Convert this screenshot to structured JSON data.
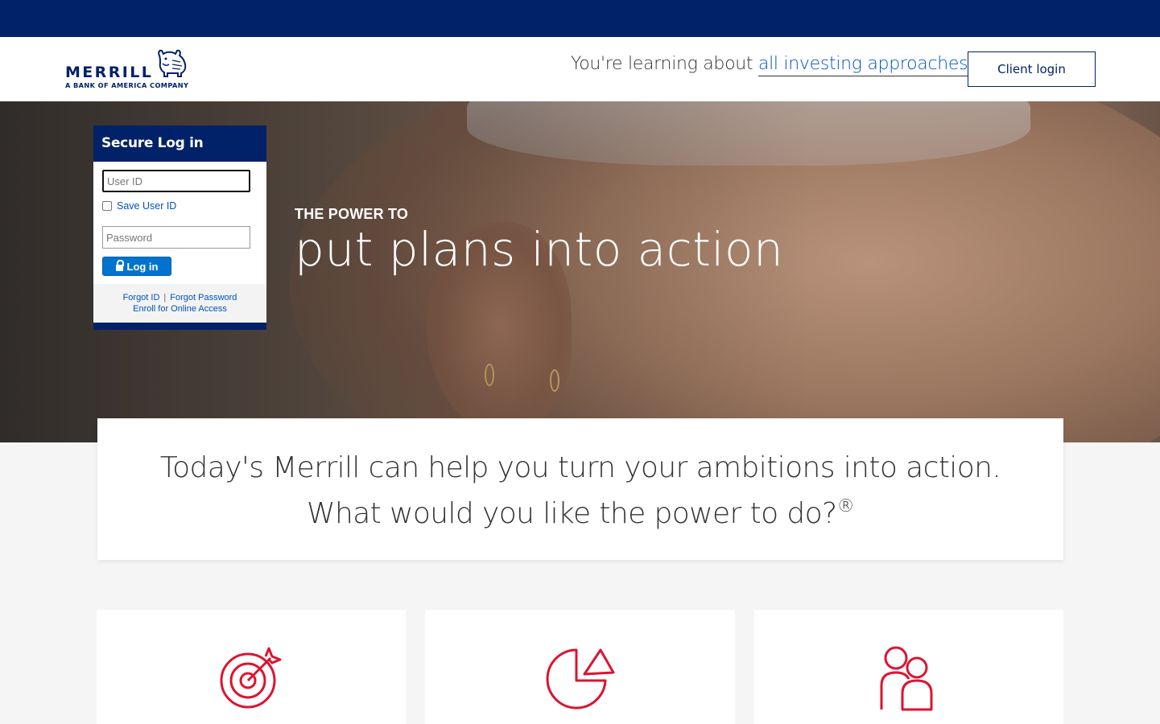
{
  "header": {
    "logo_word": "MERRILL",
    "logo_sub": "A BANK OF AMERICA COMPANY",
    "learning_prefix": "You're learning about ",
    "learning_selected": "all investing approaches",
    "client_login_label": "Client login"
  },
  "hero": {
    "eyebrow": "THE POWER TO",
    "title": "put plans into action"
  },
  "login": {
    "heading": "Secure Log in",
    "user_id_placeholder": "User ID",
    "save_user_id_label": "Save User ID",
    "password_placeholder": "Password",
    "login_button_label": "Log in",
    "forgot_id": "Forgot ID",
    "separator": "|",
    "forgot_password": "Forgot Password",
    "enroll": "Enroll for Online Access"
  },
  "intro": {
    "text": "Today's Merrill can help you turn your ambitions into action. What would you like the power to do?",
    "reg_mark": "®"
  },
  "cards": [
    {
      "icon": "target-icon"
    },
    {
      "icon": "pie-chart-icon"
    },
    {
      "icon": "people-icon"
    }
  ],
  "colors": {
    "brand_navy": "#012169",
    "link_blue": "#0052c2",
    "button_blue": "#0073cf",
    "icon_red": "#dc1431"
  }
}
